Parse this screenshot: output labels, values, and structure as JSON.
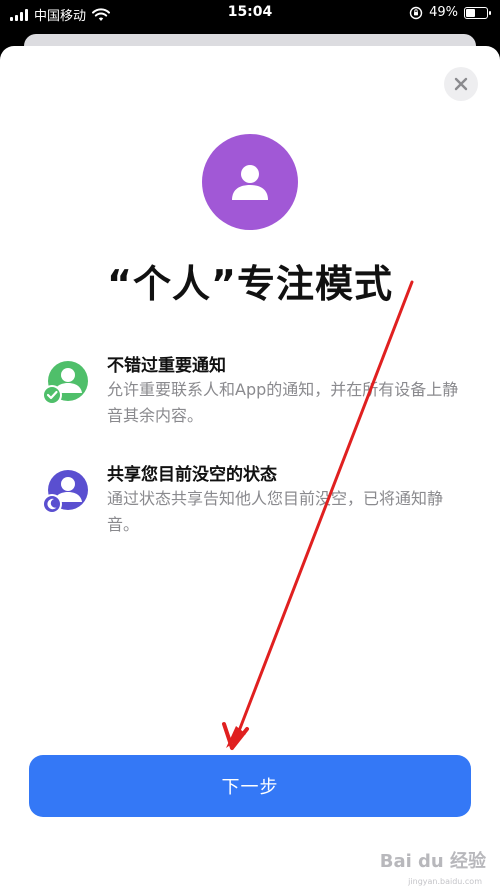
{
  "status_bar": {
    "carrier": "中国移动",
    "time": "15:04",
    "battery_percent": "49%",
    "battery_level": 0.49
  },
  "sheet": {
    "title": "“个人”专注模式",
    "features": [
      {
        "title": "不错过重要通知",
        "description": "允许重要联系人和App的通知，并在所有设备上静音其余内容。",
        "icon": "person-check-icon"
      },
      {
        "title": "共享您目前没空的状态",
        "description": "通过状态共享告知他人您目前没空，已将通知静音。",
        "icon": "person-moon-icon"
      }
    ],
    "next_label": "下一步"
  },
  "watermark": {
    "text": "Bai du 经验",
    "sub": "jingyan.baidu.com"
  },
  "colors": {
    "accent": "#3478f6",
    "avatar": "#a158d6",
    "feature1": "#4fbf6a",
    "feature2": "#5a4fd0",
    "annotation_arrow": "#e02020"
  }
}
